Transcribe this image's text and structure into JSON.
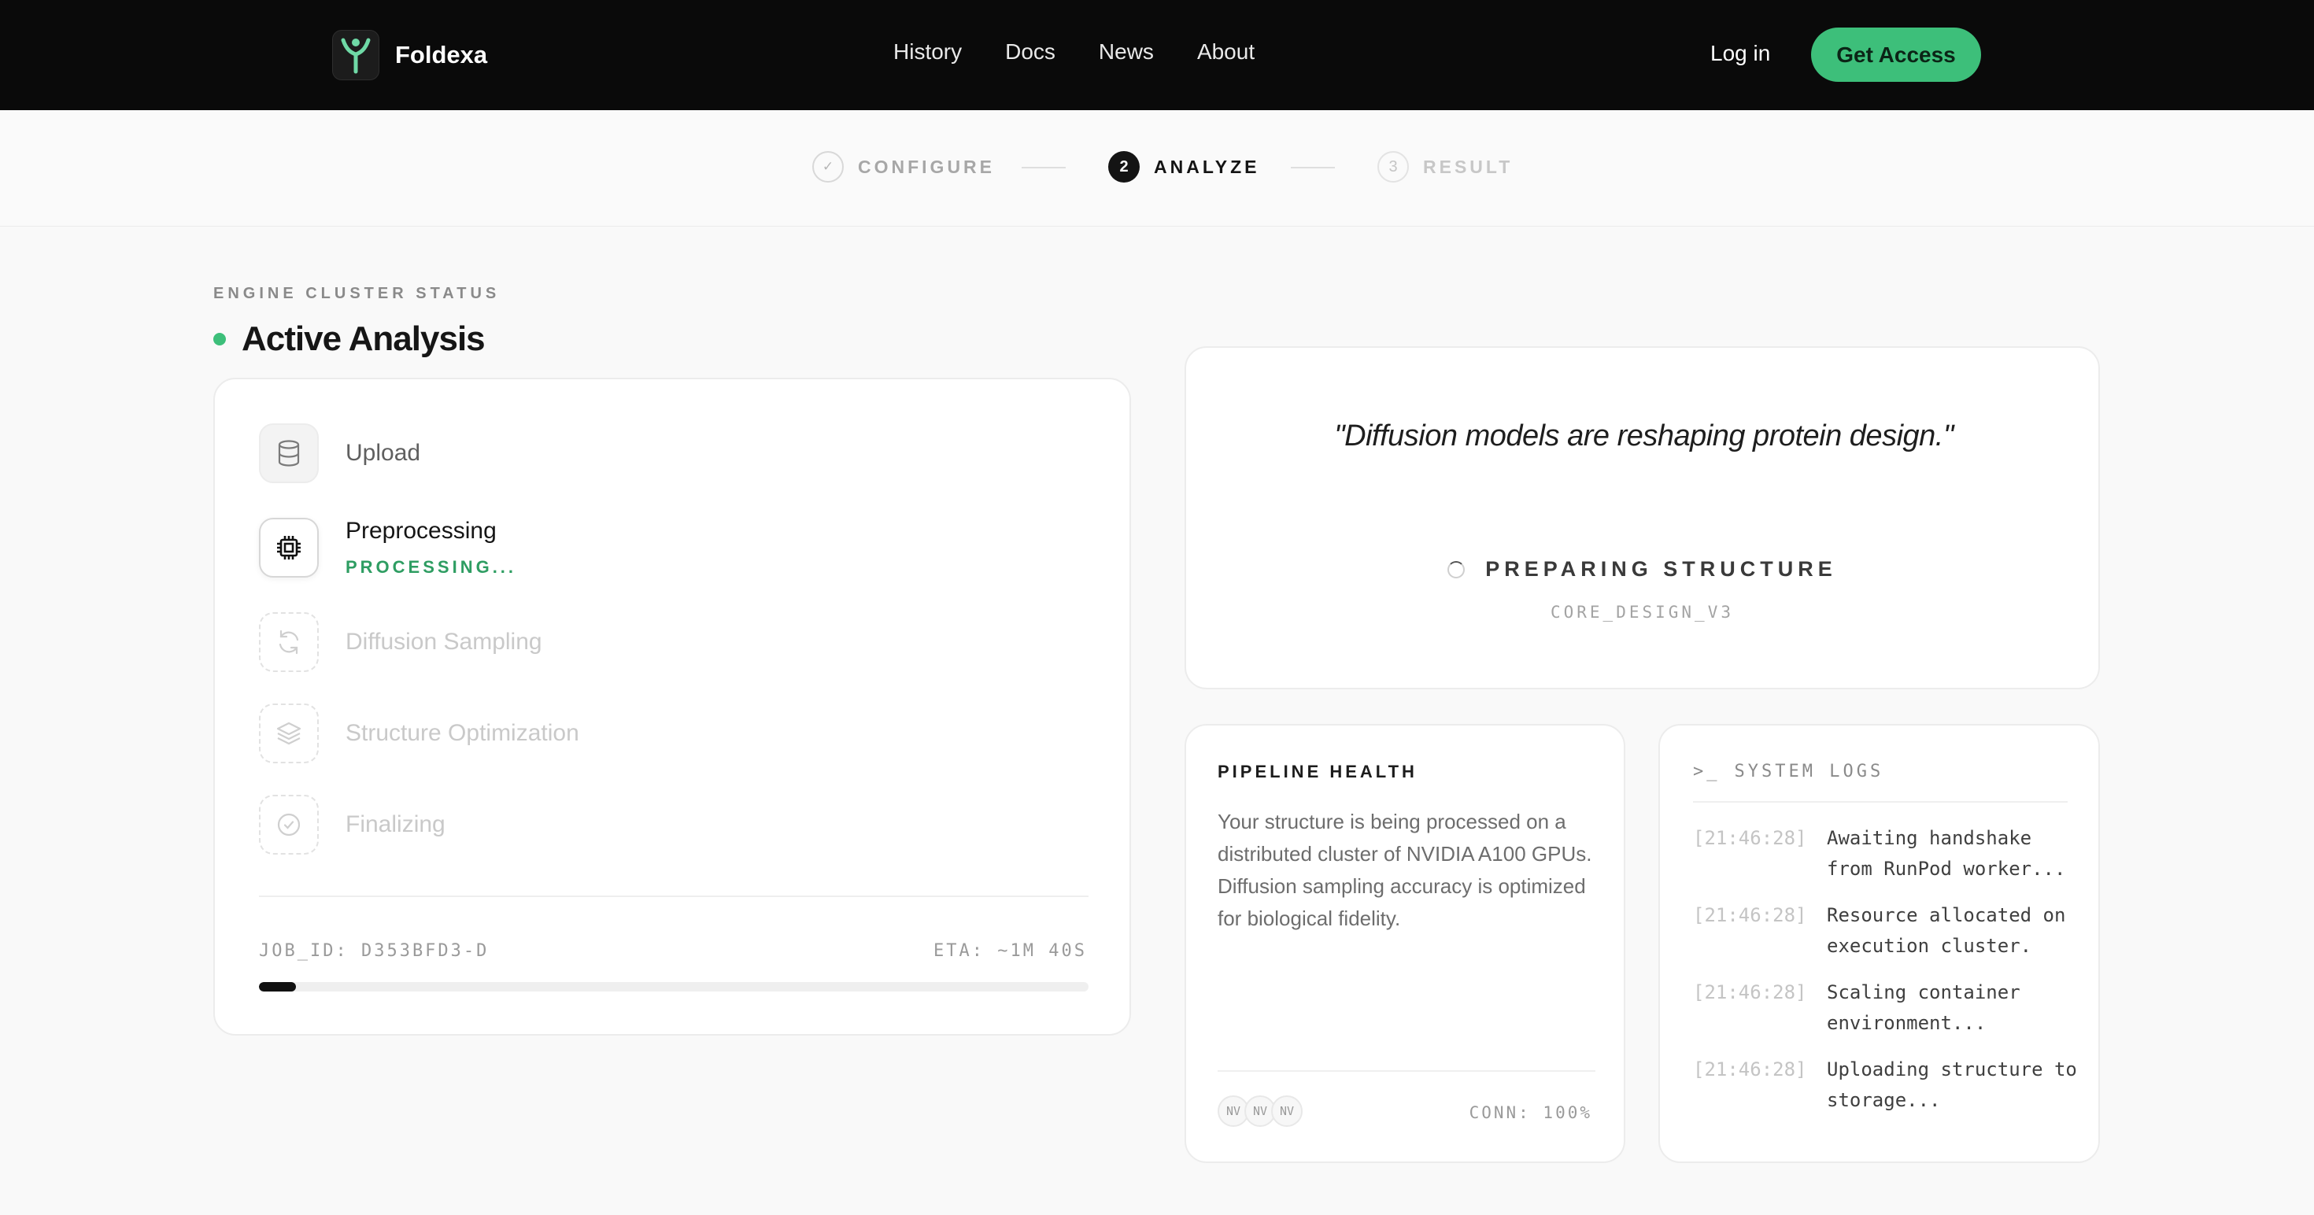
{
  "nav": {
    "brand": "Foldexa",
    "links": [
      "History",
      "Docs",
      "News",
      "About"
    ],
    "login": "Log in",
    "cta": "Get Access"
  },
  "stepper": {
    "steps": [
      {
        "index": "✓",
        "label": "CONFIGURE",
        "state": "done"
      },
      {
        "index": "2",
        "label": "ANALYZE",
        "state": "active"
      },
      {
        "index": "3",
        "label": "RESULT",
        "state": "todo"
      }
    ]
  },
  "status": {
    "eyebrow": "ENGINE CLUSTER STATUS",
    "title": "Active Analysis"
  },
  "pipeline_steps": [
    {
      "name": "Upload",
      "icon": "database-icon",
      "state": "done"
    },
    {
      "name": "Preprocessing",
      "icon": "cpu-chip-icon",
      "state": "current",
      "sub": "PROCESSING..."
    },
    {
      "name": "Diffusion Sampling",
      "icon": "refresh-icon",
      "state": "pending"
    },
    {
      "name": "Structure Optimization",
      "icon": "layers-icon",
      "state": "pending"
    },
    {
      "name": "Finalizing",
      "icon": "check-circle-icon",
      "state": "pending"
    }
  ],
  "job": {
    "id": "JOB_ID: D353BFD3-D",
    "eta": "ETA: ~1M 40S",
    "progress_fraction": 0.045
  },
  "quote": {
    "text": "\"Diffusion models are reshaping protein design.\"",
    "status": "PREPARING STRUCTURE",
    "model": "CORE_DESIGN_V3"
  },
  "health": {
    "title": "PIPELINE HEALTH",
    "body": "Your structure is being processed on a distributed cluster of NVIDIA A100 GPUs. Diffusion sampling accuracy is optimized for biological fidelity.",
    "avatars": [
      "NV",
      "NV",
      "NV"
    ],
    "conn": "CONN: 100%"
  },
  "logs": {
    "prompt": ">_",
    "title": "SYSTEM LOGS",
    "entries": [
      {
        "ts": "[21:46:28]",
        "msg": "Awaiting handshake from RunPod worker..."
      },
      {
        "ts": "[21:46:28]",
        "msg": "Resource allocated on execution cluster."
      },
      {
        "ts": "[21:46:28]",
        "msg": "Scaling container environment..."
      },
      {
        "ts": "[21:46:28]",
        "msg": "Uploading structure to storage..."
      }
    ]
  },
  "colors": {
    "accent": "#3dbf7a",
    "nav_bg": "#0a0a0a",
    "processing_text": "#2e9d62"
  }
}
